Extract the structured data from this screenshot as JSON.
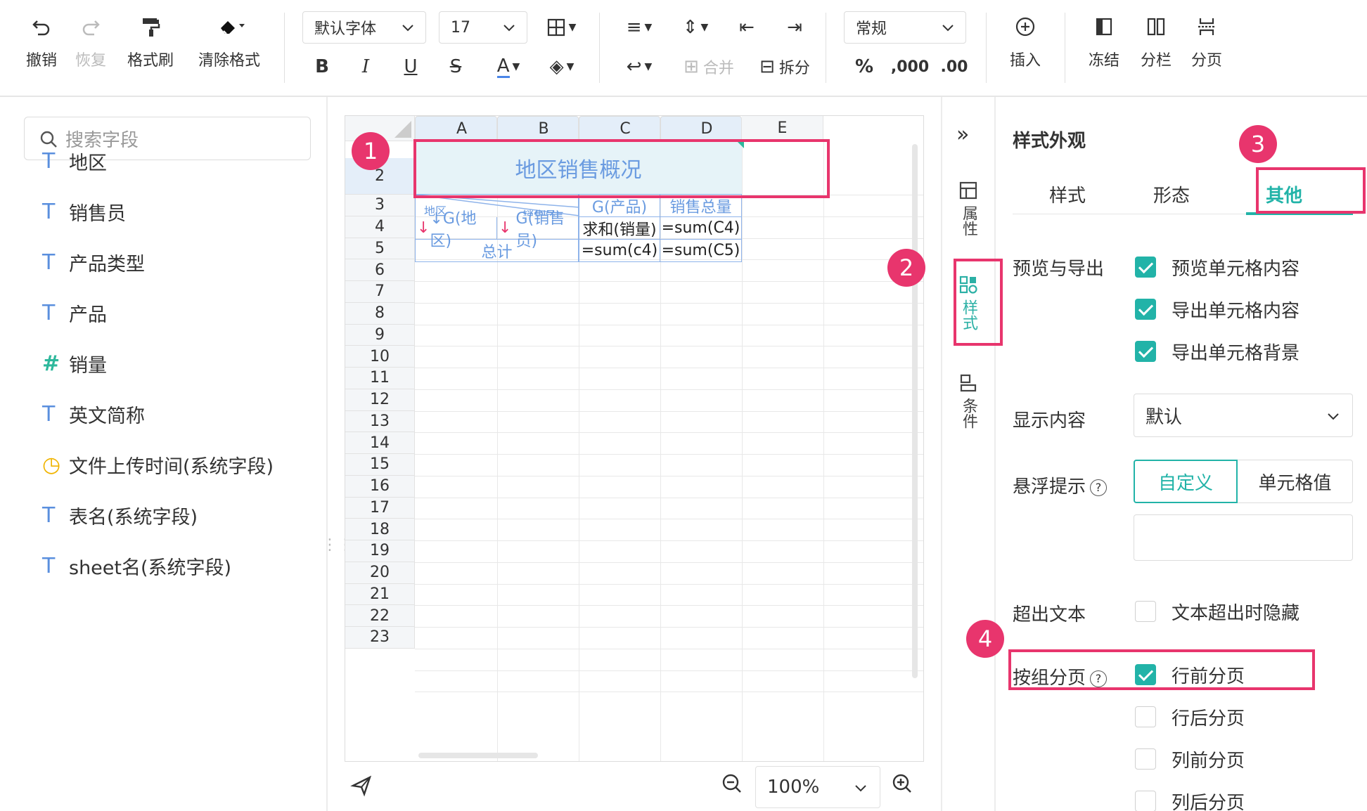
{
  "toolbar": {
    "undo": "撤销",
    "redo": "恢复",
    "format_painter": "格式刷",
    "clear_format": "清除格式",
    "font_family": "默认字体",
    "font_size": "17",
    "merge": "合并",
    "split": "拆分",
    "number_format": "常规",
    "percent": "%",
    "thousands": ",000",
    "decimal": ".00",
    "insert": "插入",
    "freeze": "冻结",
    "columns": "分栏",
    "pagination": "分页"
  },
  "left_panel": {
    "search_placeholder": "搜索字段",
    "fields": [
      {
        "type": "T",
        "name": "地区"
      },
      {
        "type": "T",
        "name": "销售员"
      },
      {
        "type": "T",
        "name": "产品类型"
      },
      {
        "type": "T",
        "name": "产品"
      },
      {
        "type": "#",
        "name": "销量"
      },
      {
        "type": "T",
        "name": "英文简称"
      },
      {
        "type": "time",
        "name": "文件上传时间(系统字段)"
      },
      {
        "type": "T",
        "name": "表名(系统字段)"
      },
      {
        "type": "T",
        "name": "sheet名(系统字段)"
      }
    ]
  },
  "sheet": {
    "columns": [
      "A",
      "B",
      "C",
      "D",
      "E"
    ],
    "rows": [
      "2",
      "3",
      "4",
      "5",
      "6",
      "7",
      "8",
      "9",
      "10",
      "11",
      "12",
      "13",
      "14",
      "15",
      "16",
      "17",
      "18",
      "19",
      "20",
      "21",
      "22",
      "23"
    ],
    "title_cell": "地区销售概况",
    "diag_label_a": "地区",
    "diag_label_b": "销售员",
    "c3": "G(产品)",
    "d3": "销售总量",
    "a4": "↓G(地区)",
    "b4": "G(销售员)",
    "c4": "求和(销量)",
    "d4": "=sum(C4)",
    "ab5": "总计",
    "c5": "=sum(c4)",
    "d5": "=sum(C5)",
    "zoom": "100%"
  },
  "sidebar": {
    "tab_properties": "属性",
    "tab_style": "样式",
    "tab_condition": "条件"
  },
  "right_panel": {
    "title": "样式外观",
    "tabs": [
      "样式",
      "形态",
      "其他"
    ],
    "preview_export_label": "预览与导出",
    "preview_cell_content": "预览单元格内容",
    "export_cell_content": "导出单元格内容",
    "export_cell_bg": "导出单元格背景",
    "display_content_label": "显示内容",
    "display_content_value": "默认",
    "tooltip_label": "悬浮提示",
    "tooltip_custom": "自定义",
    "tooltip_cell_value": "单元格值",
    "overflow_label": "超出文本",
    "overflow_hide": "文本超出时隐藏",
    "group_page_label": "按组分页",
    "page_before_row": "行前分页",
    "page_after_row": "行后分页",
    "page_before_col": "列前分页",
    "page_after_col": "列后分页"
  },
  "annotations": [
    "1",
    "2",
    "3",
    "4"
  ],
  "colors": {
    "accent": "#22b3a8",
    "annotation": "#e8356d",
    "cell_text_blue": "#6a9be0"
  }
}
